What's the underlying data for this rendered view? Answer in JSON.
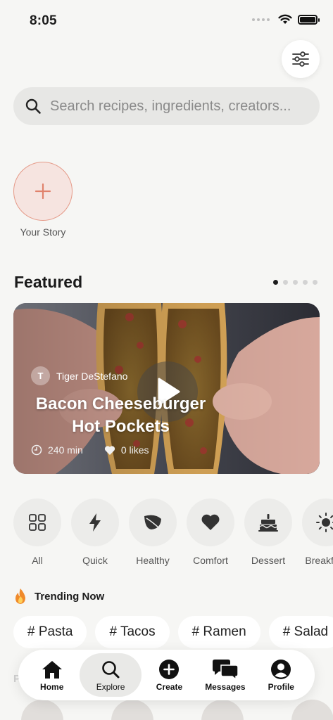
{
  "status_bar": {
    "time": "8:05"
  },
  "search": {
    "placeholder": "Search recipes, ingredients, creators..."
  },
  "story": {
    "label": "Your Story"
  },
  "featured": {
    "title": "Featured",
    "pages": 5,
    "active_page": 1,
    "card": {
      "creator_initial": "T",
      "creator_name": "Tiger DeStefano",
      "recipe_title_line1": "Bacon Cheeseburger",
      "recipe_title_line2": "Hot Pockets",
      "duration": "240 min",
      "likes": "0 likes"
    }
  },
  "categories": [
    {
      "label": "All",
      "icon": "grid-icon"
    },
    {
      "label": "Quick",
      "icon": "lightning-icon"
    },
    {
      "label": "Healthy",
      "icon": "leaf-icon"
    },
    {
      "label": "Comfort",
      "icon": "heart-icon"
    },
    {
      "label": "Dessert",
      "icon": "cake-icon"
    },
    {
      "label": "Breakfast",
      "icon": "sun-icon"
    }
  ],
  "trending": {
    "title": "Trending Now",
    "tags": [
      "# Pasta",
      "# Tacos",
      "# Ramen",
      "# Salad"
    ]
  },
  "faded_section_title": "P",
  "tab_bar": {
    "home": "Home",
    "explore": "Explore",
    "create": "Create",
    "messages": "Messages",
    "profile": "Profile",
    "active": "explore"
  },
  "colors": {
    "background": "#f6f6f4",
    "accent": "#e59a88",
    "accent_fill": "#f6e4e0",
    "text": "#1c1c1c"
  }
}
